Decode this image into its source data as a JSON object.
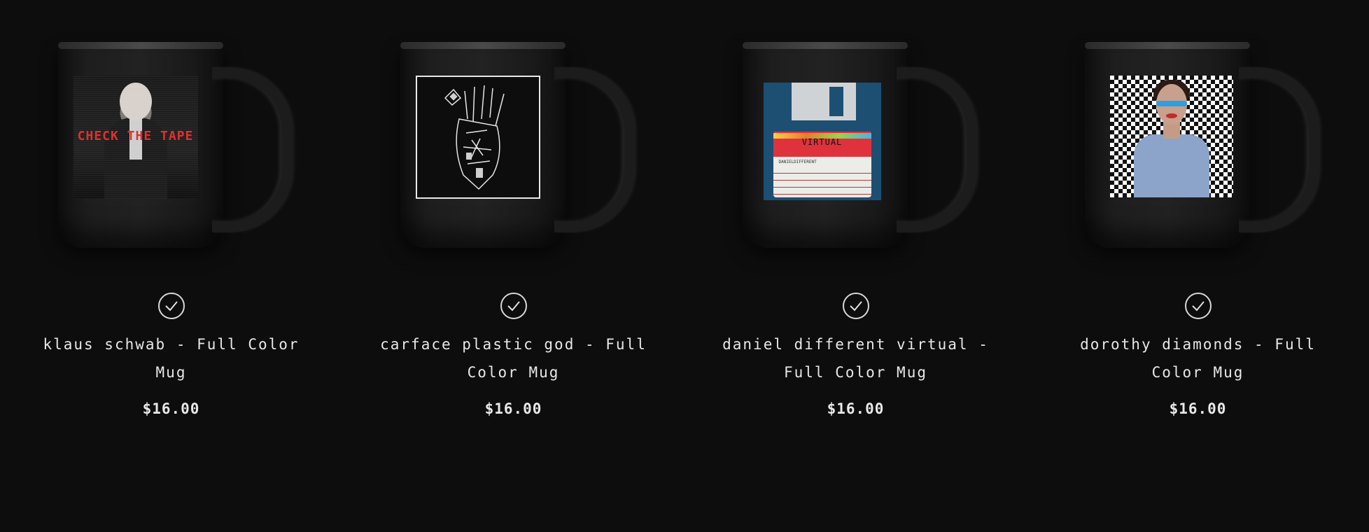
{
  "products": [
    {
      "title": "klaus schwab - Full Color Mug",
      "price": "$16.00",
      "art_caption": "CHECK THE TAPE",
      "selected": true
    },
    {
      "title": "carface plastic god - Full Color Mug",
      "price": "$16.00",
      "selected": true
    },
    {
      "title": "daniel different virtual - Full Color Mug",
      "price": "$16.00",
      "art_label": "VIRTUAL",
      "art_sublabel": "DANIELDIFFERENT",
      "selected": true
    },
    {
      "title": "dorothy diamonds - Full Color Mug",
      "price": "$16.00",
      "selected": true
    }
  ],
  "colors": {
    "background": "#0d0d0d",
    "text": "#e8e8e8",
    "accent_red": "#e0312e"
  },
  "icons": {
    "check": "check-circle-icon"
  }
}
